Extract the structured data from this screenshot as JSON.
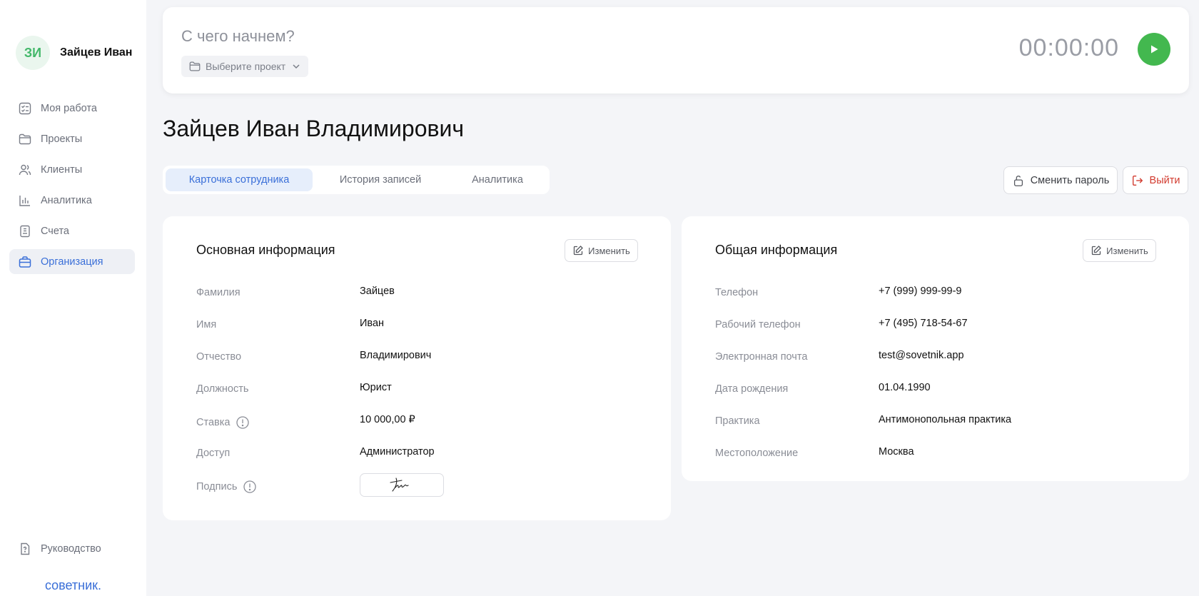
{
  "user": {
    "initials": "ЗИ",
    "name": "Зайцев Иван"
  },
  "sidebar": {
    "items": [
      {
        "label": "Моя работа",
        "icon": "checklist-icon"
      },
      {
        "label": "Проекты",
        "icon": "folder-icon"
      },
      {
        "label": "Клиенты",
        "icon": "users-icon"
      },
      {
        "label": "Аналитика",
        "icon": "bar-chart-icon"
      },
      {
        "label": "Счета",
        "icon": "invoice-icon"
      },
      {
        "label": "Организация",
        "icon": "briefcase-icon",
        "active": true
      }
    ],
    "guide_label": "Руководство",
    "brand": "советник."
  },
  "topbar": {
    "question": "С чего начнем?",
    "project_placeholder": "Выберите проект",
    "timer": "00:00:00"
  },
  "page": {
    "title": "Зайцев Иван Владимирович"
  },
  "tabs": [
    {
      "label": "Карточка сотрудника",
      "active": true
    },
    {
      "label": "История записей"
    },
    {
      "label": "Аналитика"
    }
  ],
  "actions": {
    "change_password": "Сменить пароль",
    "logout": "Выйти"
  },
  "main_card": {
    "title": "Основная информация",
    "edit_label": "Изменить",
    "rows": [
      {
        "label": "Фамилия",
        "value": "Зайцев"
      },
      {
        "label": "Имя",
        "value": "Иван"
      },
      {
        "label": "Отчество",
        "value": "Владимирович"
      },
      {
        "label": "Должность",
        "value": "Юрист"
      },
      {
        "label": "Ставка",
        "value": "10 000,00 ₽"
      },
      {
        "label": "Доступ",
        "value": "Администратор"
      },
      {
        "label": "Подпись"
      }
    ]
  },
  "general_card": {
    "title": "Общая информация",
    "edit_label": "Изменить",
    "rows": [
      {
        "label": "Телефон",
        "value": "+7 (999) 999-99-9"
      },
      {
        "label": "Рабочий телефон",
        "value": "+7 (495) 718-54-67"
      },
      {
        "label": "Электронная почта",
        "value": "test@sovetnik.app"
      },
      {
        "label": "Дата рождения",
        "value": "01.04.1990"
      },
      {
        "label": "Практика",
        "value": "Антимонопольная практика"
      },
      {
        "label": "Местоположение",
        "value": "Москва"
      }
    ]
  },
  "colors": {
    "accent": "#3a6fd8",
    "play": "#43b84f",
    "danger": "#d23a2e",
    "avatar_bg": "#eaf6ee",
    "avatar_text": "#43b86a"
  }
}
